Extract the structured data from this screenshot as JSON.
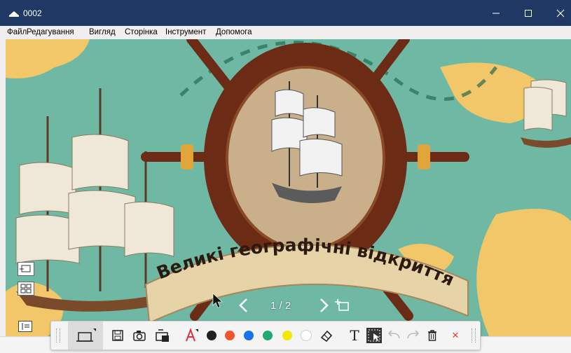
{
  "window": {
    "title": "0002"
  },
  "menu": {
    "items": [
      "Файл",
      "Редагування",
      "Вигляд",
      "Сторінка",
      "Інструмент",
      "Допомога"
    ]
  },
  "slide": {
    "title_banner": "Великі географічні відкриття"
  },
  "pager": {
    "text": "1 / 2"
  },
  "toolbar": {
    "colors": {
      "black": "#222222",
      "red": "#f0552e",
      "blue": "#1a73e8",
      "green": "#22a870",
      "yellow": "#f5e800",
      "white": "#ffffff"
    },
    "text_tool_label": "T",
    "close_glyph": "×"
  },
  "palette": {
    "titlebar": "#1f3864",
    "sea": "#6fb8a3",
    "land": "#f1c76a",
    "wood": "#6b2b14"
  }
}
